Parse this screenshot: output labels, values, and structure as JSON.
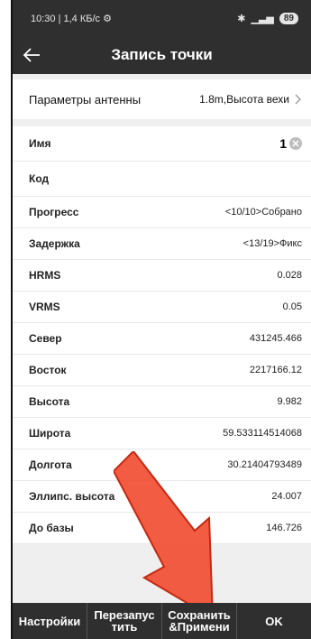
{
  "status_bar": {
    "left_text": "10:30 | 1,4 КБ/с ⚙",
    "battery": "89"
  },
  "app_bar": {
    "title": "Запись точки"
  },
  "antenna": {
    "label": "Параметры антенны",
    "value": "1.8m,Высота вехи"
  },
  "fields": {
    "name": {
      "label": "Имя",
      "value": "1"
    },
    "code": {
      "label": "Код",
      "value": ""
    },
    "rows": [
      {
        "label": "Прогресс",
        "value": "<10/10>Собрано"
      },
      {
        "label": "Задержка",
        "value": "<13/19>Фикс"
      },
      {
        "label": "HRMS",
        "value": "0.028"
      },
      {
        "label": "VRMS",
        "value": "0.05"
      },
      {
        "label": "Север",
        "value": "431245.466"
      },
      {
        "label": "Восток",
        "value": "2217166.12"
      },
      {
        "label": "Высота",
        "value": "9.982"
      },
      {
        "label": "Широта",
        "value": "59.533114514068"
      },
      {
        "label": "Долгота",
        "value": "30.21404793489"
      },
      {
        "label": "Эллипс. высота",
        "value": "24.007"
      },
      {
        "label": "До базы",
        "value": "146.726"
      }
    ]
  },
  "bottom_buttons": {
    "settings": "Настройки",
    "restart_line1": "Перезапус",
    "restart_line2": "тить",
    "save_line1": "Сохранить",
    "save_line2": "&Примени",
    "ok": "OK"
  },
  "colors": {
    "bar": "#2f2f2f",
    "background": "#efefef",
    "arrow": "#f04a2e"
  }
}
